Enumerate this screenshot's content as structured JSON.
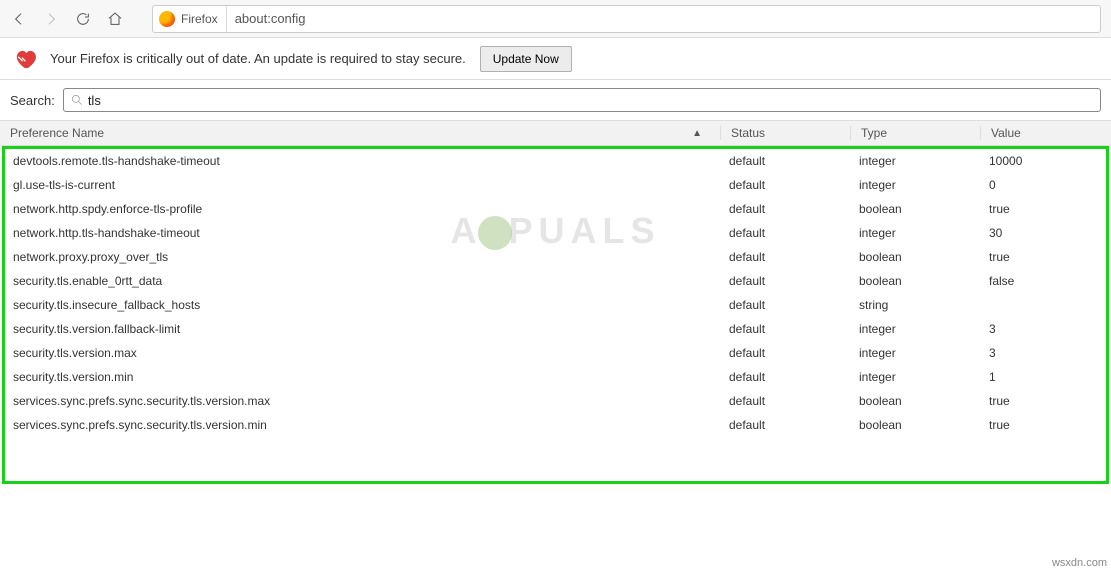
{
  "toolbar": {
    "identity_label": "Firefox",
    "url": "about:config"
  },
  "notice": {
    "text": "Your Firefox is critically out of date. An update is required to stay secure.",
    "button_label": "Update Now"
  },
  "search": {
    "label": "Search:",
    "value": "tls"
  },
  "columns": {
    "name": "Preference Name",
    "status": "Status",
    "type": "Type",
    "value": "Value",
    "sort_indicator": "▲"
  },
  "prefs": [
    {
      "name": "devtools.remote.tls-handshake-timeout",
      "status": "default",
      "type": "integer",
      "value": "10000"
    },
    {
      "name": "gl.use-tls-is-current",
      "status": "default",
      "type": "integer",
      "value": "0"
    },
    {
      "name": "network.http.spdy.enforce-tls-profile",
      "status": "default",
      "type": "boolean",
      "value": "true"
    },
    {
      "name": "network.http.tls-handshake-timeout",
      "status": "default",
      "type": "integer",
      "value": "30"
    },
    {
      "name": "network.proxy.proxy_over_tls",
      "status": "default",
      "type": "boolean",
      "value": "true"
    },
    {
      "name": "security.tls.enable_0rtt_data",
      "status": "default",
      "type": "boolean",
      "value": "false"
    },
    {
      "name": "security.tls.insecure_fallback_hosts",
      "status": "default",
      "type": "string",
      "value": ""
    },
    {
      "name": "security.tls.version.fallback-limit",
      "status": "default",
      "type": "integer",
      "value": "3"
    },
    {
      "name": "security.tls.version.max",
      "status": "default",
      "type": "integer",
      "value": "3"
    },
    {
      "name": "security.tls.version.min",
      "status": "default",
      "type": "integer",
      "value": "1"
    },
    {
      "name": "services.sync.prefs.sync.security.tls.version.max",
      "status": "default",
      "type": "boolean",
      "value": "true"
    },
    {
      "name": "services.sync.prefs.sync.security.tls.version.min",
      "status": "default",
      "type": "boolean",
      "value": "true"
    }
  ],
  "watermark": {
    "prefix": "A",
    "suffix": "PUALS"
  },
  "credit": "wsxdn.com"
}
